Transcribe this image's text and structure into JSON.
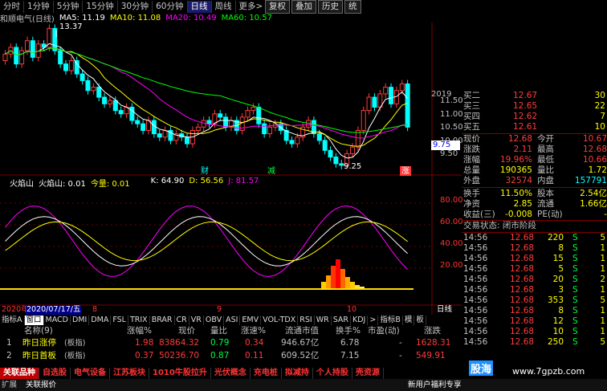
{
  "title": "和顺电气(日线)",
  "tabs": [
    "分时",
    "1分钟",
    "5分钟",
    "15分钟",
    "30分钟",
    "60分钟",
    "日线",
    "周线",
    "更多>"
  ],
  "active_tab": "日线",
  "right_buttons": [
    "复权",
    "叠加",
    "历史",
    "统"
  ],
  "ma": {
    "ma5": "MA5: 11.19",
    "ma10": "MA10: 11.08",
    "ma20": "MA20: 10.49",
    "ma60": "MA60: 10.57"
  },
  "price_axis": [
    "11.50",
    "11.00",
    "10.50",
    "10.00",
    "9.50"
  ],
  "price_axis_top": "2019",
  "current_price_tag": "9.75",
  "annotations": {
    "high": "13.37",
    "low": "9.25",
    "cai": "财",
    "jian": "减",
    "zhang": "涨"
  },
  "indicator": {
    "name": "火焰山",
    "label": "火焰山: 0.01",
    "vol": "今量: 0.01",
    "k": "K: 64.90",
    "d": "D: 56.56",
    "j": "J: 81.57",
    "axis": [
      "80.00",
      "60.00",
      "40.00",
      "20.00"
    ]
  },
  "date_axis": {
    "year": "2020年",
    "date": "2020/07/17/五",
    "m8": "8",
    "m9": "9",
    "m10": "10",
    "right": "日线"
  },
  "bottom_toolbar": [
    "指标A",
    "窗口",
    "MACD",
    "DMI",
    "DMA",
    "FSL",
    "TRIX",
    "BRAR",
    "CR",
    "VR",
    "OBV",
    "ASI",
    "EMV",
    "VOL-TDX",
    "RSI",
    "WR",
    "SAR",
    "KDJ",
    ">",
    "指标B",
    "模",
    "板"
  ],
  "list_header": {
    "name": "名称(9)",
    "zf": "涨幅%",
    "xj": "现价",
    "lb": "量比",
    "zs": "涨速%",
    "ltsz": "流通市值",
    "hs": "换手%",
    "syl": "市盈(动)",
    "zt": "涨跌"
  },
  "list_rows": [
    {
      "idx": "1",
      "name": "昨日涨停",
      "tag": "(板指)",
      "zf": "1.98",
      "xj": "83864.32",
      "lb": "0.79",
      "zs": "0.34",
      "ltsz": "946.67亿",
      "hs": "6.78",
      "syl": "-",
      "zt": "1628.31"
    },
    {
      "idx": "2",
      "name": "昨日首板",
      "tag": "(板指)",
      "zf": "0.37",
      "xj": "50236.70",
      "lb": "0.87",
      "zs": "0.11",
      "ltsz": "609.52亿",
      "hs": "7.15",
      "syl": "-",
      "zt": "549.91"
    }
  ],
  "cat_tabs": [
    "关联品种",
    "自选股",
    "电气设备",
    "江苏板块",
    "1010牛股拉升",
    "光伏概念",
    "充电桩",
    "拟减持",
    "个人持股",
    "壳资源"
  ],
  "status": {
    "left1": "扩展",
    "left2": "关联报价",
    "right": "新用户福利专享"
  },
  "watermark": "www.7gpzb.com",
  "watermark2": "股海",
  "quote": {
    "asks": [
      {
        "l": "买二",
        "p": "12.67",
        "v": "30"
      },
      {
        "l": "买三",
        "p": "12.65",
        "v": "22"
      },
      {
        "l": "买四",
        "p": "12.62",
        "v": "7"
      },
      {
        "l": "买五",
        "p": "12.61",
        "v": "10"
      }
    ],
    "rows": [
      {
        "l1": "现价",
        "v1": "12.68",
        "l2": "今开",
        "v2": "10.67"
      },
      {
        "l1": "涨跌",
        "v1": "2.11",
        "l2": "最高",
        "v2": "12.68"
      },
      {
        "l1": "涨幅",
        "v1": "19.96%",
        "l2": "最低",
        "v2": "10.66"
      },
      {
        "l1": "总量",
        "v1": "190365",
        "l2": "量比",
        "v2": "1.72"
      },
      {
        "l1": "外盘",
        "v1": "32574",
        "l2": "内盘",
        "v2": "157791"
      },
      {
        "l1": "换手",
        "v1": "11.50%",
        "l2": "股本",
        "v2": "2.54亿"
      },
      {
        "l1": "净资",
        "v1": "2.85",
        "l2": "流通",
        "v2": "1.66亿"
      },
      {
        "l1": "收益(三)",
        "v1": "-0.008",
        "l2": "PE(动)",
        "v2": "-"
      }
    ],
    "status": "交易状态: 闭市阶段",
    "ticks": [
      {
        "t": "14:56",
        "p": "12.68",
        "v": "220",
        "s": "S",
        "n": "5"
      },
      {
        "t": "14:56",
        "p": "12.68",
        "v": "8",
        "s": "S",
        "n": "1"
      },
      {
        "t": "14:56",
        "p": "12.68",
        "v": "15",
        "s": "S",
        "n": "1"
      },
      {
        "t": "14:56",
        "p": "12.68",
        "v": "5",
        "s": "S",
        "n": "1"
      },
      {
        "t": "14:56",
        "p": "12.68",
        "v": "20",
        "s": "S",
        "n": "2"
      },
      {
        "t": "14:56",
        "p": "12.68",
        "v": "3",
        "s": "S",
        "n": "1"
      },
      {
        "t": "14:56",
        "p": "12.68",
        "v": "353",
        "s": "S",
        "n": "5"
      },
      {
        "t": "14:56",
        "p": "12.68",
        "v": "8",
        "s": "S",
        "n": "1"
      },
      {
        "t": "14:56",
        "p": "12.68",
        "v": "12",
        "s": "S",
        "n": "1"
      },
      {
        "t": "14:56",
        "p": "12.68",
        "v": "10",
        "s": "S",
        "n": "1"
      },
      {
        "t": "14:56",
        "p": "12.68",
        "v": "250",
        "s": "S",
        "n": "5"
      }
    ]
  },
  "colors": {
    "up": "#ff3c3c",
    "down": "#00ffff",
    "ma5": "#ffffff",
    "ma10": "#ffff00",
    "ma20": "#ff00ff",
    "ma60": "#00ff00"
  }
}
